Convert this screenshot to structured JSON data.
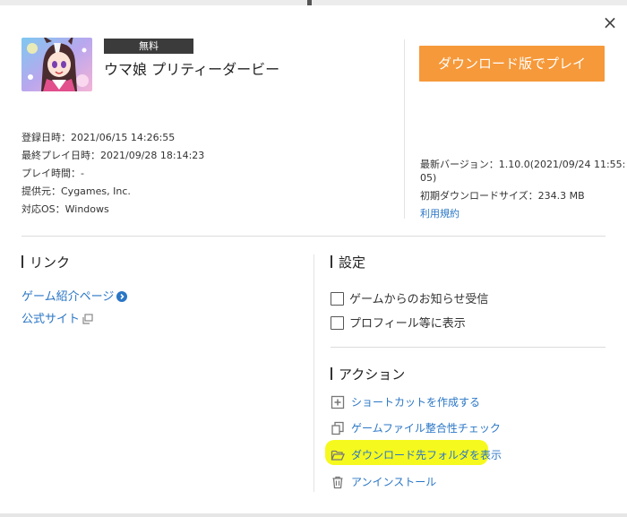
{
  "window": {
    "close_label": "×"
  },
  "game": {
    "badge": "無料",
    "title": "ウマ娘 プリティーダービー",
    "download_button": "ダウンロード版でプレイ"
  },
  "info_left": [
    "登録日時：2021/06/15 14:26:55",
    "最終プレイ日時：2021/09/28 18:14:23",
    "プレイ時間：-",
    "提供元：Cygames, Inc.",
    "対応OS：Windows"
  ],
  "info_right": {
    "version_line1": "最新バージョン：1.10.0(2021/09/24 11:55:",
    "version_line2": "05)",
    "size": "初期ダウンロードサイズ：234.3 MB",
    "terms": "利用規約"
  },
  "links": {
    "heading": "リンク",
    "items": [
      {
        "label": "ゲーム紹介ページ",
        "icon": "arrow-circle-icon"
      },
      {
        "label": "公式サイト",
        "icon": "external-window-icon"
      }
    ]
  },
  "settings": {
    "heading": "設定",
    "options": [
      {
        "label": "ゲームからのお知らせ受信",
        "checked": false
      },
      {
        "label": "プロフィール等に表示",
        "checked": false
      }
    ]
  },
  "actions": {
    "heading": "アクション",
    "items": [
      {
        "label": "ショートカットを作成する",
        "icon": "plus-box-icon"
      },
      {
        "label": "ゲームファイル整合性チェック",
        "icon": "file-copy-icon"
      },
      {
        "label": "ダウンロード先フォルダを表示",
        "icon": "folder-open-icon",
        "highlight_color": "#f6f91e"
      },
      {
        "label": "アンインストール",
        "icon": "trash-icon"
      }
    ]
  },
  "colors": {
    "accent": "#f6993a",
    "link": "#2a76c6",
    "badge_bg": "#3b3b3b"
  }
}
